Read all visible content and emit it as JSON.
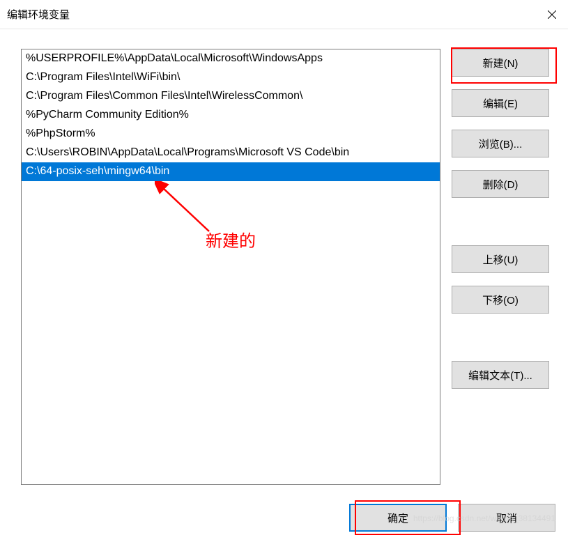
{
  "window": {
    "title": "编辑环境变量"
  },
  "list": {
    "items": [
      "%USERPROFILE%\\AppData\\Local\\Microsoft\\WindowsApps",
      "C:\\Program Files\\Intel\\WiFi\\bin\\",
      "C:\\Program Files\\Common Files\\Intel\\WirelessCommon\\",
      "%PyCharm Community Edition%",
      "%PhpStorm%",
      "C:\\Users\\ROBIN\\AppData\\Local\\Programs\\Microsoft VS Code\\bin",
      "C:\\64-posix-seh\\mingw64\\bin"
    ],
    "selected_index": 6
  },
  "buttons": {
    "new": "新建(N)",
    "edit": "编辑(E)",
    "browse": "浏览(B)...",
    "delete": "删除(D)",
    "move_up": "上移(U)",
    "move_down": "下移(O)",
    "edit_text": "编辑文本(T)...",
    "ok": "确定",
    "cancel": "取消"
  },
  "annotation": {
    "text": "新建的"
  },
  "watermark": "https://blog.csdn.net/weixin_38134491"
}
